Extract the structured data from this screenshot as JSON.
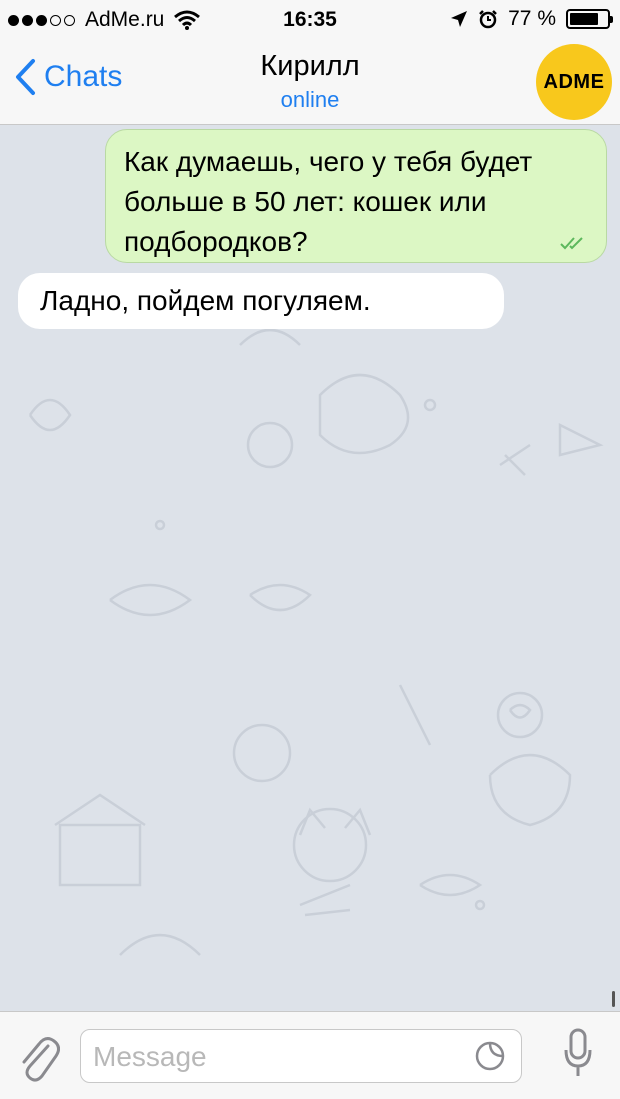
{
  "status_bar": {
    "carrier": "AdMe.ru",
    "time": "16:35",
    "battery": "77 %",
    "battery_level": 0.77,
    "signal_dots_filled": 3,
    "signal_dots_total": 5
  },
  "header": {
    "back_label": "Chats",
    "contact_name": "Кирилл",
    "contact_status": "online",
    "avatar_text": "ADME"
  },
  "messages": [
    {
      "direction": "outgoing",
      "text": "Как думаешь, чего у тебя будет больше в 50 лет: кошек или подбородков?",
      "read": true
    },
    {
      "direction": "incoming",
      "text": "Ладно, пойдем погуляем."
    }
  ],
  "composer": {
    "placeholder": "Message"
  },
  "colors": {
    "accent": "#1f7ff0",
    "outgoing_bubble": "#dcf7c4",
    "incoming_bubble": "#ffffff",
    "chat_background": "#dde2e9",
    "avatar": "#f8c81c",
    "read_checks": "#5cb85c"
  },
  "icons": [
    "wifi-icon",
    "location-arrow-icon",
    "alarm-icon",
    "battery-icon",
    "chevron-left-icon",
    "double-check-icon",
    "paperclip-icon",
    "sticker-icon",
    "microphone-icon"
  ]
}
